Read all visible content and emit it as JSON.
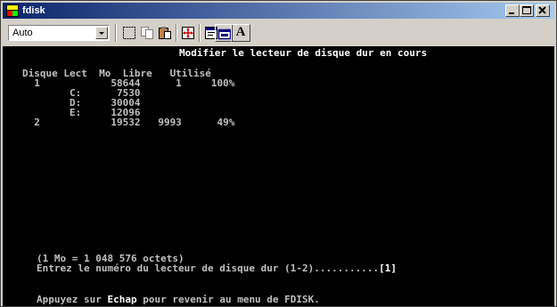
{
  "window": {
    "title": "fdisk",
    "icon": "ms-dos-icon",
    "controls": [
      "minimize-icon",
      "maximize-icon",
      "close-icon"
    ]
  },
  "toolbar": {
    "font_size_value": "Auto",
    "buttons": [
      "mark-icon",
      "copy-icon",
      "paste-icon",
      "fullscreen-icon",
      "properties-icon",
      "background-icon"
    ],
    "font_button_label": "A"
  },
  "console": {
    "header": "Modifier le lecteur de disque dur en cours",
    "columns": "Disque Lect  Mo  Libre   Utilisé",
    "rows": [
      "  1            58644      1     100%",
      "        C:      7530",
      "        D:     30004",
      "        E:     12096",
      "  2            19532   9993      49%"
    ],
    "note": "(1 Mo = 1 048 576 octets)",
    "prompt": "Entrez le numéro du lecteur de disque dur (1-2)...........",
    "prompt_value": "[1]",
    "footer_before": "Appuyez sur ",
    "footer_key": "Echap",
    "footer_after": " pour revenir au menu de FDISK."
  },
  "colors": {
    "titlebar_start": "#0a246a",
    "titlebar_end": "#a6caf0",
    "console_bg": "#000000",
    "console_text": "#c0c0c0",
    "console_bright": "#ffffff"
  }
}
